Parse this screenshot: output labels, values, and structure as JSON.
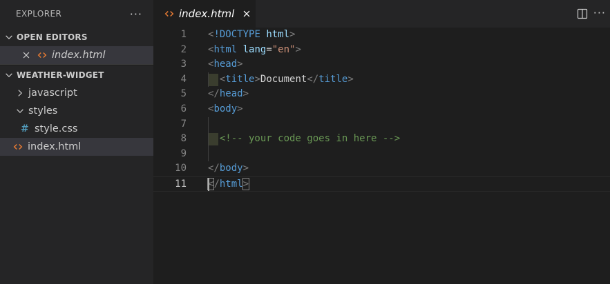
{
  "sidebar": {
    "header_title": "EXPLORER",
    "more_label": "···",
    "open_editors": {
      "title": "OPEN EDITORS",
      "items": [
        {
          "label": "index.html",
          "icon": "html-icon"
        }
      ]
    },
    "workspace": {
      "title": "WEATHER-WIDGET",
      "items": [
        {
          "label": "javascript",
          "type": "folder",
          "expanded": false
        },
        {
          "label": "styles",
          "type": "folder",
          "expanded": true
        },
        {
          "label": "style.css",
          "type": "file",
          "icon": "css-hash-icon"
        },
        {
          "label": "index.html",
          "type": "file",
          "icon": "html-icon",
          "selected": true
        }
      ]
    }
  },
  "editor": {
    "tab": {
      "label": "index.html",
      "icon": "html-icon"
    },
    "more_label": "···",
    "line_numbers": [
      "1",
      "2",
      "3",
      "4",
      "5",
      "6",
      "7",
      "8",
      "9",
      "10",
      "11"
    ],
    "active_line": "11",
    "code": {
      "doctype": "!DOCTYPE",
      "html_kw": "html",
      "lang_attr": "lang",
      "lang_val": "\"en\"",
      "head": "head",
      "title": "title",
      "title_text": "Document",
      "body": "body",
      "comment": "<!-- your code goes in here -->"
    }
  },
  "colors": {
    "sidebar_bg": "#252526",
    "editor_bg": "#1e1e1e",
    "tag": "#569cd6",
    "attr": "#9cdcfe",
    "string": "#ce9178",
    "comment": "#6a9955",
    "html_icon": "#e37933",
    "css_icon": "#519aba"
  }
}
